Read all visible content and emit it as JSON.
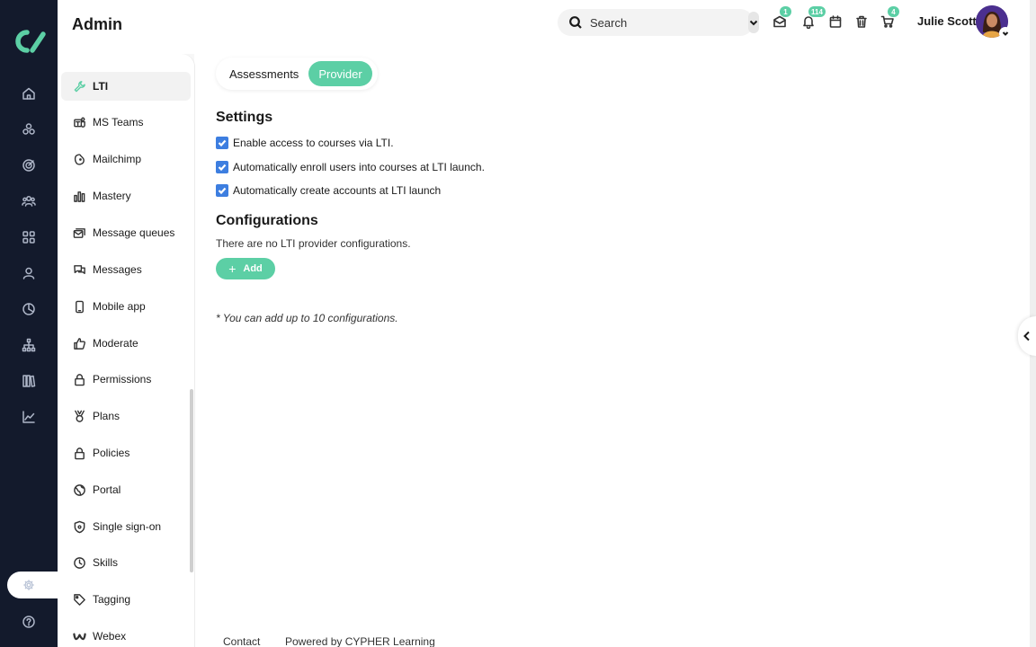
{
  "header": {
    "title": "Admin",
    "search_placeholder": "Search",
    "badges": {
      "messages": "1",
      "notifications": "114",
      "cart": "4"
    },
    "username": "Julie Scott"
  },
  "rail": {
    "icons": [
      "home-icon",
      "courses-icon",
      "target-icon",
      "groups-icon",
      "apps-icon",
      "user-icon",
      "analytics-pie-icon",
      "org-chart-icon",
      "library-icon",
      "trend-chart-icon",
      "settings-gear-icon",
      "help-icon"
    ]
  },
  "sidebar": {
    "items": [
      {
        "label": "LTI",
        "icon": "wrench-icon",
        "active": true
      },
      {
        "label": "MS Teams",
        "icon": "ms-teams-icon"
      },
      {
        "label": "Mailchimp",
        "icon": "mailchimp-icon"
      },
      {
        "label": "Mastery",
        "icon": "bars-icon"
      },
      {
        "label": "Message queues",
        "icon": "message-queue-icon"
      },
      {
        "label": "Messages",
        "icon": "chat-icon"
      },
      {
        "label": "Mobile app",
        "icon": "mobile-icon"
      },
      {
        "label": "Moderate",
        "icon": "thumbs-up-icon"
      },
      {
        "label": "Permissions",
        "icon": "lock-icon"
      },
      {
        "label": "Plans",
        "icon": "medal-icon"
      },
      {
        "label": "Policies",
        "icon": "lock-icon"
      },
      {
        "label": "Portal",
        "icon": "globe-icon"
      },
      {
        "label": "Single sign-on",
        "icon": "shield-icon"
      },
      {
        "label": "Skills",
        "icon": "clock-icon"
      },
      {
        "label": "Tagging",
        "icon": "tag-icon"
      },
      {
        "label": "Webex",
        "icon": "webex-icon"
      }
    ]
  },
  "tabs": [
    {
      "label": "Assessments",
      "active": false
    },
    {
      "label": "Provider",
      "active": true
    }
  ],
  "settings": {
    "heading": "Settings",
    "options": [
      {
        "label": "Enable access to courses via LTI.",
        "checked": true
      },
      {
        "label": "Automatically enroll users into courses at LTI launch.",
        "checked": true
      },
      {
        "label": "Automatically create accounts at LTI launch",
        "checked": true
      }
    ]
  },
  "configurations": {
    "heading": "Configurations",
    "empty_text": "There are no LTI provider configurations.",
    "add_label": "Add",
    "note": "* You can add up to 10 configurations."
  },
  "footer": {
    "contact": "Contact",
    "powered_by": "Powered by CYPHER Learning"
  },
  "colors": {
    "accent": "#5ccfa5",
    "rail_bg": "#131a2c",
    "checkbox": "#3d7ee0"
  }
}
